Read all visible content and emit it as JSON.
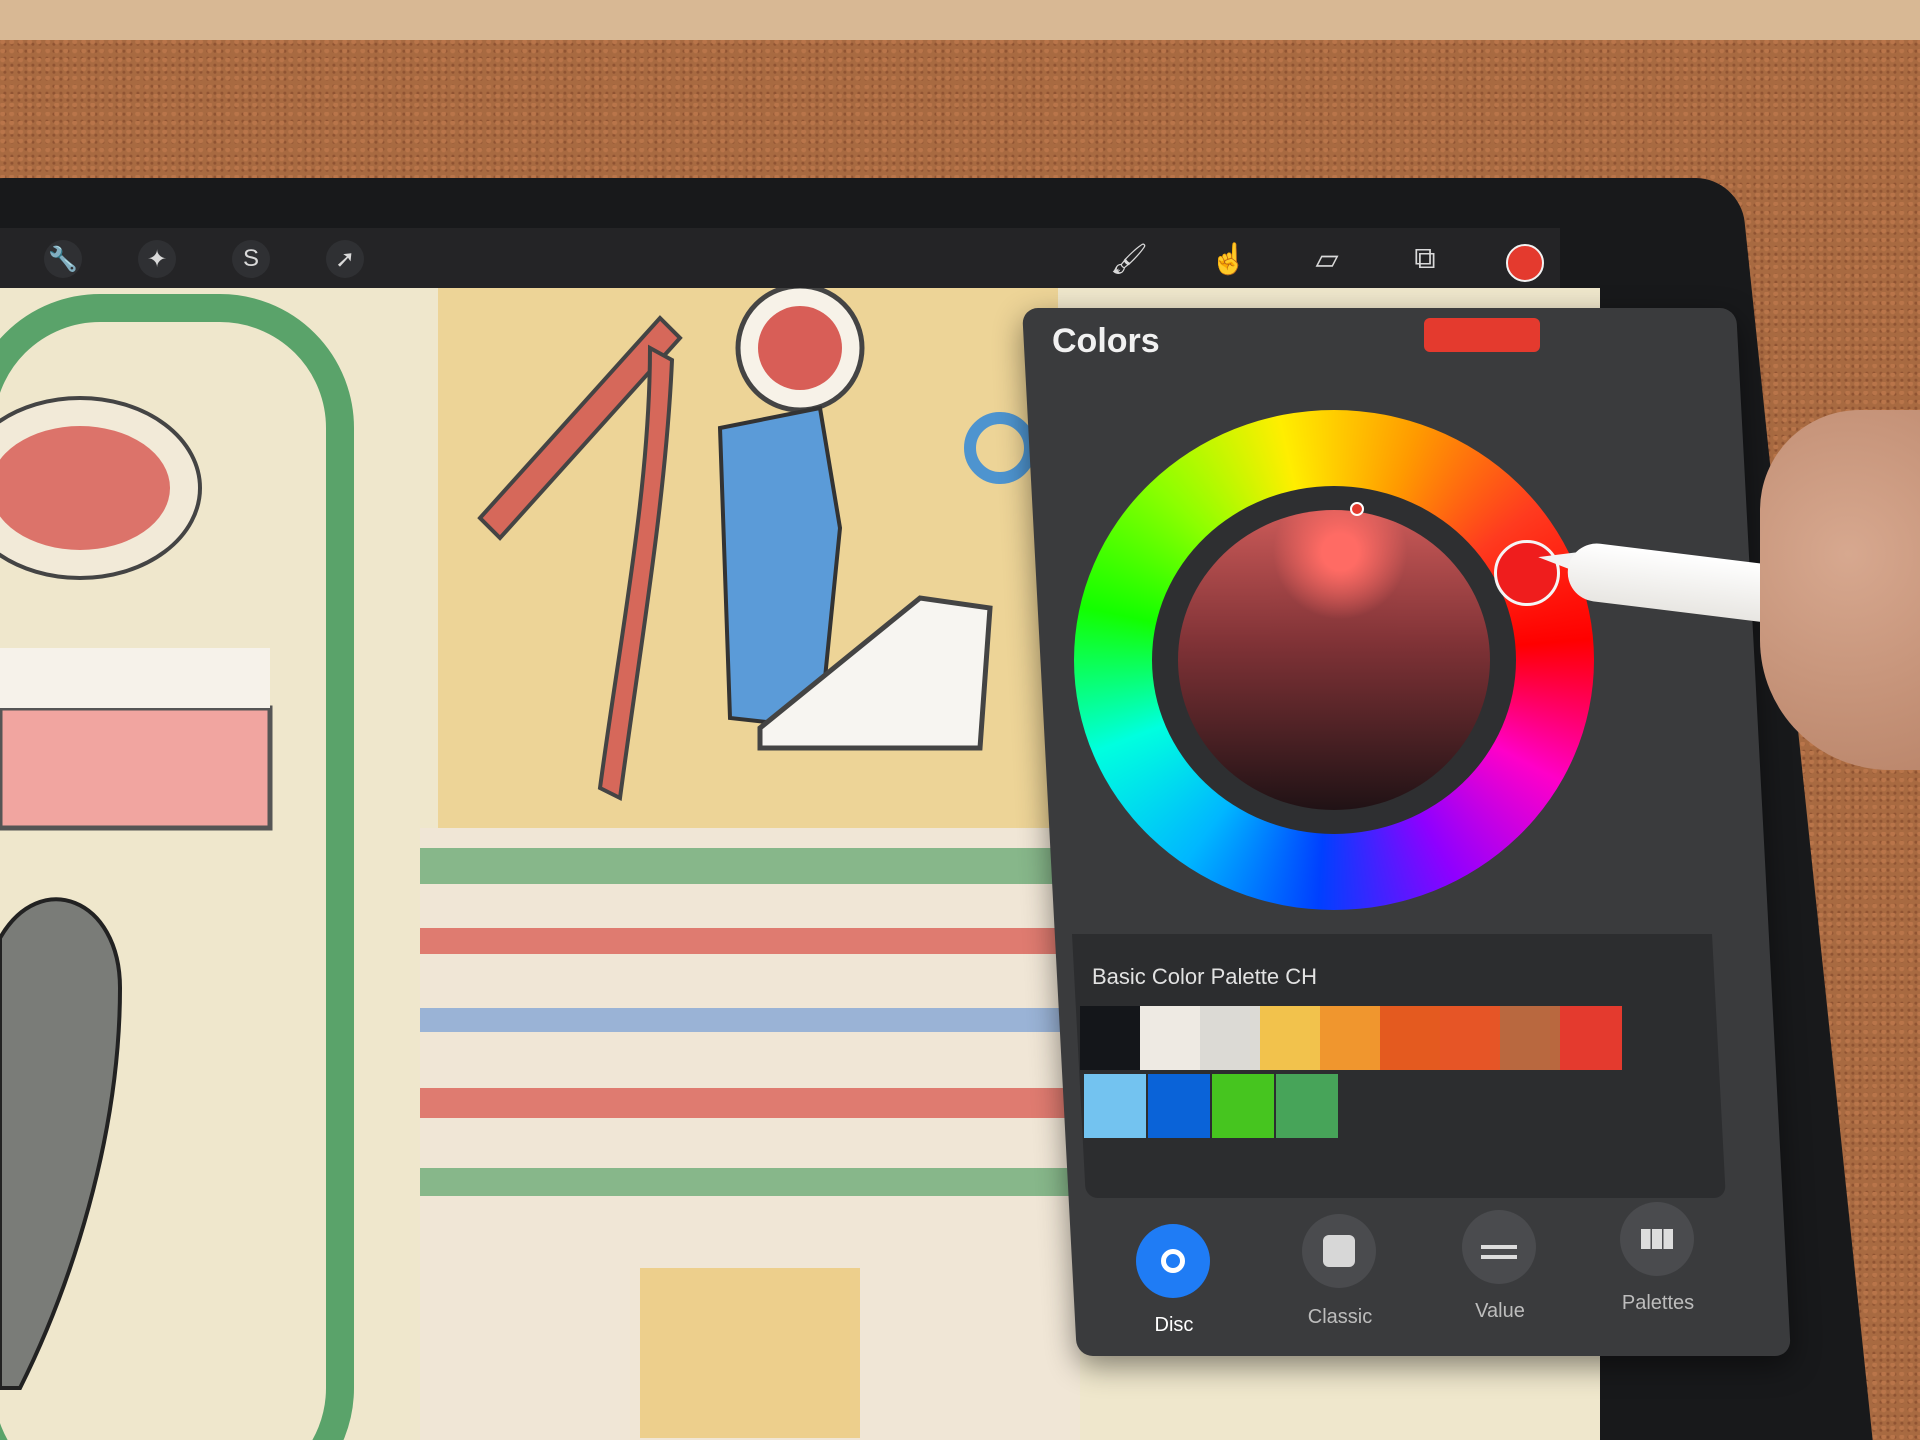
{
  "app": {
    "toolbar": {
      "left_tools": [
        "wrench-icon",
        "magic-wand-icon",
        "selection-icon",
        "transform-arrow-icon"
      ],
      "right_tools": [
        "brush-icon",
        "smudge-icon",
        "eraser-icon",
        "layers-icon"
      ],
      "current_color": "#e43a2e"
    },
    "colors_panel": {
      "title": "Colors",
      "current_color": "#e43a2e",
      "palette": {
        "name": "Basic Color Palette CH",
        "row1": [
          "#14161a",
          "#eeeae3",
          "#dcdad5",
          "#f2c24c",
          "#f0962e",
          "#e45a1f",
          "#e65526",
          "#b9683f",
          "#e43a2e"
        ],
        "row2": [
          "#73c3f0",
          "#0a63d8",
          "#46c51f",
          "#47a459"
        ]
      },
      "tabs": [
        {
          "label": "Disc",
          "active": true
        },
        {
          "label": "Classic",
          "active": false
        },
        {
          "label": "Value",
          "active": false
        },
        {
          "label": "Palettes",
          "active": false
        }
      ]
    }
  }
}
